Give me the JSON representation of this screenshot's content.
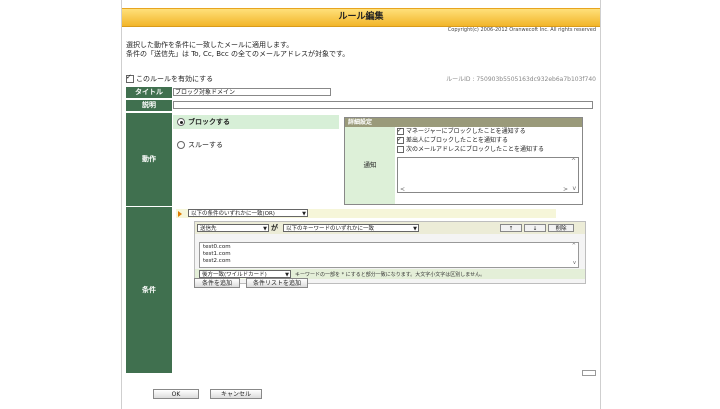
{
  "window": {
    "title": "ルール編集",
    "copyright": "Copyright(c) 2006-2012 Oranwecoft Inc. All rights reserved"
  },
  "description": {
    "line1": "選択した動作を条件に一致したメールに適用します。",
    "line2": "条件の「送信先」は To, Cc, Bcc の全てのメールアドレスが対象です。"
  },
  "enable": {
    "label": "このルールを有効にする",
    "checked": true,
    "rule_id": "ルールID : 750903b5505163dc932eb6a7b103f740"
  },
  "fields": {
    "title_label": "タイトル",
    "title_value": "ブロック対象ドメイン",
    "desc_label": "説明",
    "desc_value": ""
  },
  "action": {
    "label": "動作",
    "block_label": "ブロックする",
    "through_label": "スルーする",
    "selected": "block"
  },
  "detail": {
    "header": "詳細設定",
    "notify_label": "通知",
    "options": [
      {
        "label": "マネージャーにブロックしたことを通知する",
        "checked": true
      },
      {
        "label": "差出人にブロックしたことを通知する",
        "checked": true
      },
      {
        "label": "次のメールアドレスにブロックしたことを通知する",
        "checked": false
      }
    ]
  },
  "conditions": {
    "label": "条件",
    "match_select": "以下の条件のいずれかに一致(OR)",
    "field_select": "送信先",
    "particle": "が",
    "keyword_select": "以下のキーワードのいずれかに一致",
    "up_label": "↑",
    "down_label": "↓",
    "delete_label": "削除",
    "keywords": [
      "test0.com",
      "test1.com",
      "test2.com"
    ],
    "match_type": "後方一致(ワイルドカード)",
    "note": "キーワードの一部を * にすると部分一致になります。大文字小文字は区別しません。",
    "add_condition": "条件を追加",
    "add_condition_list": "条件リストを追加"
  },
  "buttons": {
    "ok": "OK",
    "cancel": "キャンセル"
  }
}
